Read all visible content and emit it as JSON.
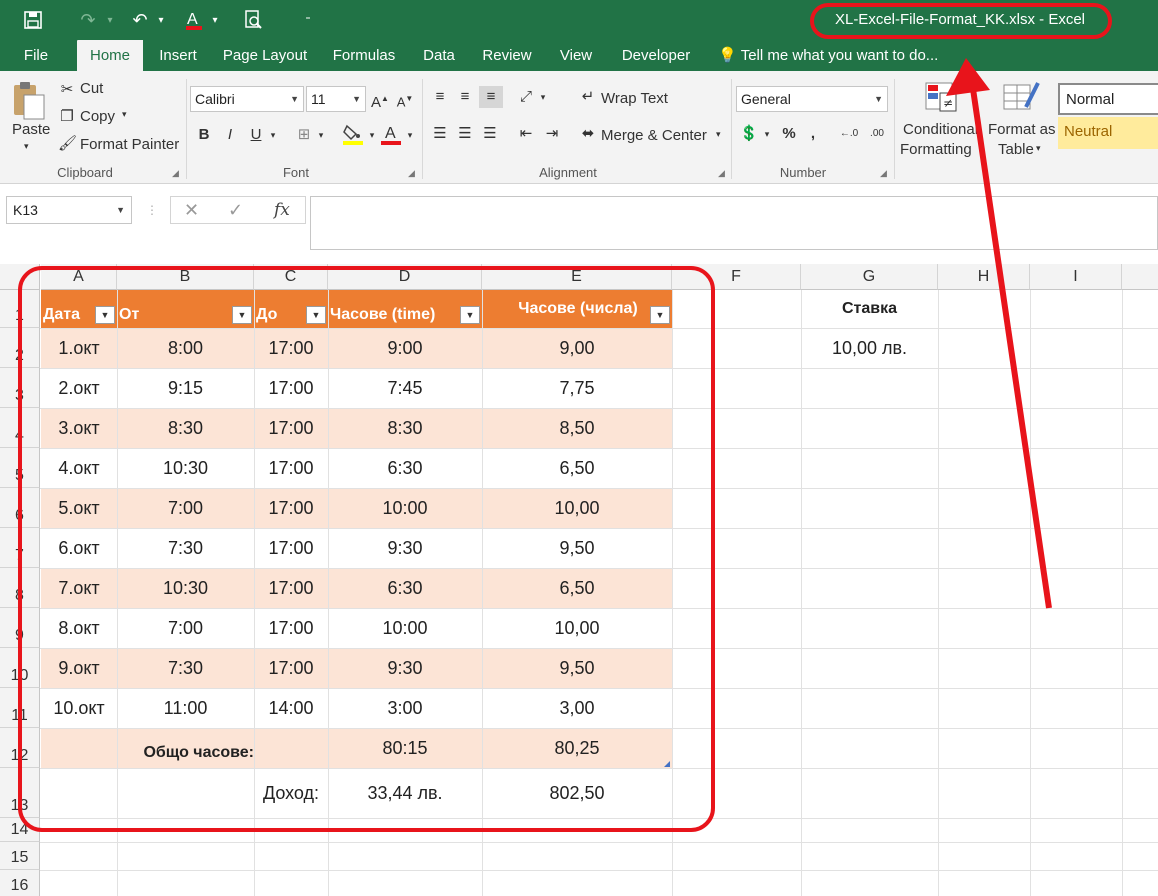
{
  "app": {
    "document_title": "XL-Excel-File-Format_KK.xlsx - Excel"
  },
  "tabs": [
    "File",
    "Home",
    "Insert",
    "Page Layout",
    "Formulas",
    "Data",
    "Review",
    "View",
    "Developer"
  ],
  "tell_me": "Tell me what you want to do...",
  "ribbon": {
    "clipboard": {
      "paste": "Paste",
      "cut": "Cut",
      "copy": "Copy",
      "format_painter": "Format Painter",
      "label": "Clipboard"
    },
    "font": {
      "name": "Calibri",
      "size": "11",
      "label": "Font"
    },
    "alignment": {
      "wrap_text": "Wrap Text",
      "merge_center": "Merge & Center",
      "label": "Alignment"
    },
    "number": {
      "format": "General",
      "label": "Number"
    },
    "styles": {
      "conditional_line1": "Conditional",
      "conditional_line2": "Formatting",
      "format_as_line1": "Format as",
      "format_as_line2": "Table",
      "normal": "Normal",
      "neutral": "Neutral"
    }
  },
  "formula_bar": {
    "name_box": "K13",
    "formula": ""
  },
  "columns": [
    "A",
    "B",
    "C",
    "D",
    "E",
    "F",
    "G",
    "H",
    "I"
  ],
  "rows": [
    "1",
    "2",
    "3",
    "4",
    "5",
    "6",
    "7",
    "8",
    "9",
    "10",
    "11",
    "12",
    "13",
    "14",
    "15",
    "16"
  ],
  "table": {
    "headers": [
      "Дата",
      "От",
      "До",
      "Часове (time)",
      "Часове (числа)"
    ],
    "rows": [
      [
        "1.окт",
        "8:00",
        "17:00",
        "9:00",
        "9,00"
      ],
      [
        "2.окт",
        "9:15",
        "17:00",
        "7:45",
        "7,75"
      ],
      [
        "3.окт",
        "8:30",
        "17:00",
        "8:30",
        "8,50"
      ],
      [
        "4.окт",
        "10:30",
        "17:00",
        "6:30",
        "6,50"
      ],
      [
        "5.окт",
        "7:00",
        "17:00",
        "10:00",
        "10,00"
      ],
      [
        "6.окт",
        "7:30",
        "17:00",
        "9:30",
        "9,50"
      ],
      [
        "7.окт",
        "10:30",
        "17:00",
        "6:30",
        "6,50"
      ],
      [
        "8.окт",
        "7:00",
        "17:00",
        "10:00",
        "10,00"
      ],
      [
        "9.окт",
        "7:30",
        "17:00",
        "9:30",
        "9,50"
      ],
      [
        "10.окт",
        "11:00",
        "14:00",
        "3:00",
        "3,00"
      ]
    ],
    "total_label": "Общо часове:",
    "total_time": "80:15",
    "total_number": "80,25",
    "income_label": "Доход:",
    "income_time": "33,44 лв.",
    "income_number": "802,50"
  },
  "side": {
    "rate_label": "Ставка",
    "rate_value": "10,00 лв."
  },
  "colors": {
    "excel_green": "#217346",
    "table_header": "#ed7d31",
    "band_light": "#fce4d6",
    "annotation_red": "#e8141b",
    "neutral_style": "#ffeb9c"
  }
}
